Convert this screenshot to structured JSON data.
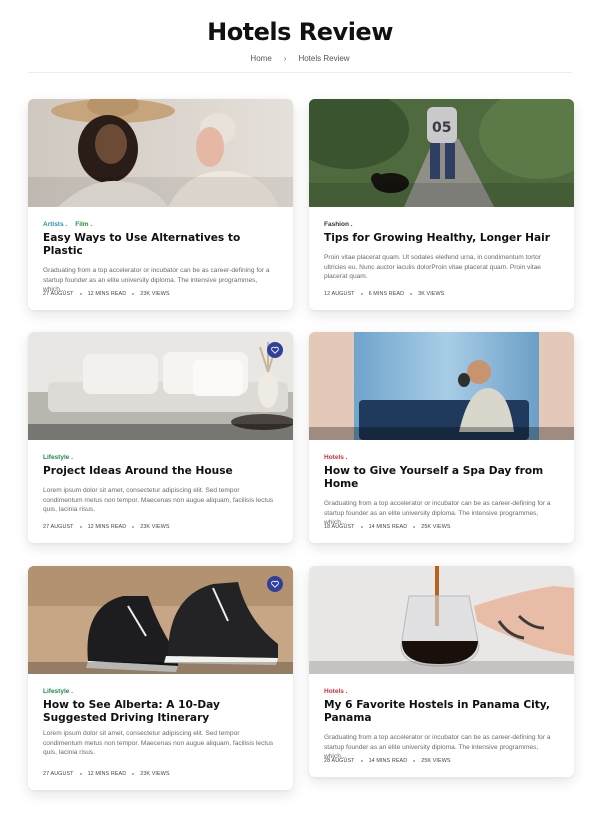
{
  "page": {
    "title": "Hotels Review",
    "breadcrumb": {
      "home": "Home",
      "separator": "›",
      "current": "Hotels Review"
    }
  },
  "colors": {
    "artists": "#2a8fb5",
    "film": "#2a8f3c",
    "fashion": "#333333",
    "lifestyle": "#1e8a4a",
    "hotels": "#d42a3a",
    "favorite_badge": "#2f3f9c"
  },
  "posts": [
    {
      "categories": [
        {
          "label": "Artists",
          "color": "#2a8fb5"
        },
        {
          "label": "Film",
          "color": "#2a8f3c"
        }
      ],
      "title": "Easy Ways to Use Alternatives to Plastic",
      "excerpt": "Graduating from a top accelerator or incubator can be as career-defining for a startup founder as an elite university diploma. The intensive programmes, which...",
      "date": "27 AUGUST",
      "read_time": "12 MINS READ",
      "views": "23K VIEWS",
      "image_icon": "photo-couple-straw-hat",
      "favorite": false
    },
    {
      "categories": [
        {
          "label": "Fashion",
          "color": "#333333"
        }
      ],
      "title": "Tips for Growing Healthy, Longer Hair",
      "excerpt": "Proin vitae placerat quam. Ut sodales eleifend urna, in condimentum tortor ultricies eu. Nunc auctor iaculis dolorProin vitae placerat quam. Proin vitae placerat quam.",
      "date": "12 AUGUST",
      "read_time": "6 MINS READ",
      "views": "3K VIEWS",
      "image_icon": "photo-person-walking-dog",
      "favorite": false
    },
    {
      "categories": [
        {
          "label": "Lifestyle",
          "color": "#1e8a4a"
        }
      ],
      "title": "Project Ideas Around the House",
      "excerpt": "Lorem ipsum dolor sit amet, consectetur adipiscing elit. Sed tempor condimentum metus non tempor. Maecenas non augue aliquam, facilisis lectus quis, lacinia risus.",
      "date": "27 AUGUST",
      "read_time": "12 MINS READ",
      "views": "23K VIEWS",
      "image_icon": "photo-living-room-sofa",
      "favorite": true
    },
    {
      "categories": [
        {
          "label": "Hotels",
          "color": "#d42a3a"
        }
      ],
      "title": "How to Give Yourself a Spa Day from Home",
      "excerpt": "Graduating from a top accelerator or incubator can be as career-defining for a startup founder as an elite university diploma. The intensive programmes, which...",
      "date": "18 AUGUST",
      "read_time": "14 MINS READ",
      "views": "25K VIEWS",
      "image_icon": "photo-man-drinking-coffee",
      "favorite": false
    },
    {
      "categories": [
        {
          "label": "Lifestyle",
          "color": "#1e8a4a"
        }
      ],
      "title": "How to See Alberta: A 10-Day Suggested Driving Itinerary",
      "excerpt": "Lorem ipsum dolor sit amet, consectetur adipiscing elit. Sed tempor condimentum metus non tempor. Maecenas non augue aliquam, facilisis lectus quis, lacinia risus.",
      "date": "27 AUGUST",
      "read_time": "12 MINS READ",
      "views": "23K VIEWS",
      "image_icon": "photo-sneakers",
      "favorite": true
    },
    {
      "categories": [
        {
          "label": "Hotels",
          "color": "#d42a3a"
        }
      ],
      "title": "My 6 Favorite Hostels in Panama City, Panama",
      "excerpt": "Graduating from a top accelerator or incubator can be as career-defining for a startup founder as an elite university diploma. The intensive programmes, which...",
      "date": "28 AUGUST",
      "read_time": "14 MINS READ",
      "views": "25K VIEWS",
      "image_icon": "photo-coffee-pour",
      "favorite": false
    }
  ]
}
